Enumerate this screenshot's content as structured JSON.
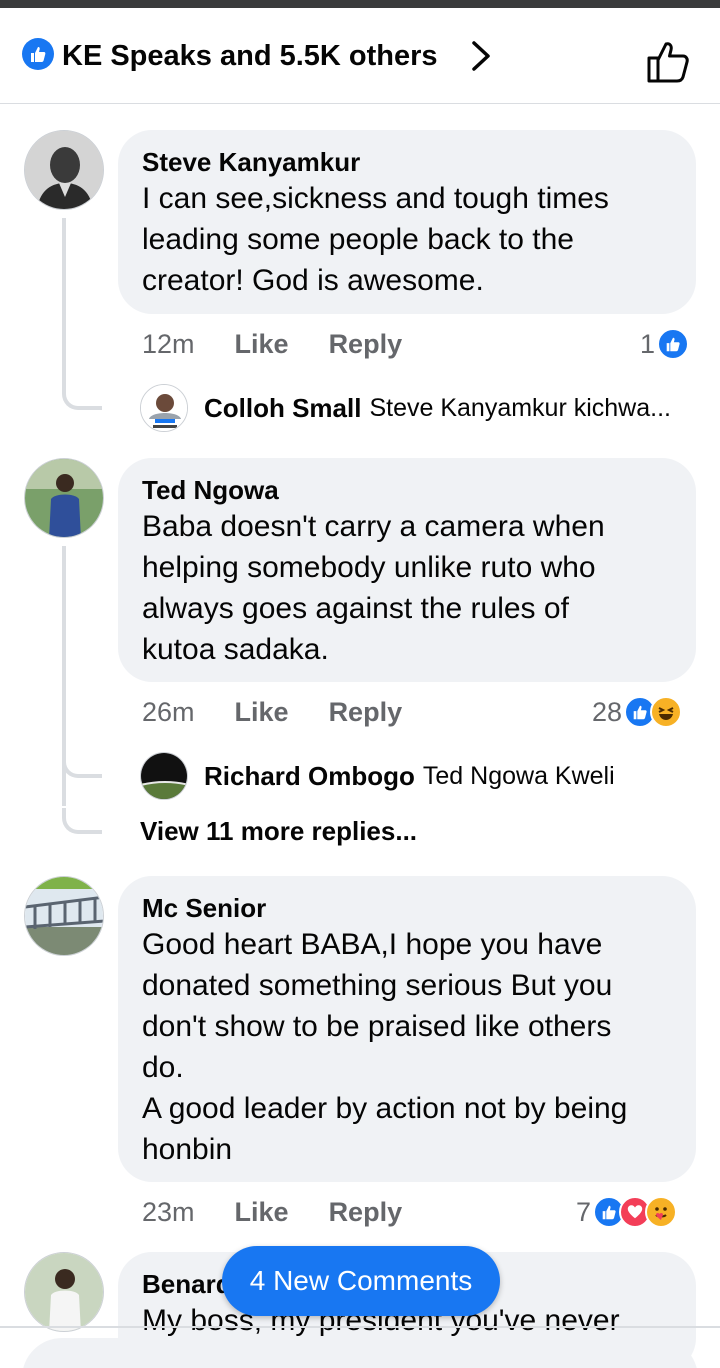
{
  "header": {
    "summary": "KE Speaks and 5.5K others"
  },
  "comments": [
    {
      "author": "Steve Kanyamkur",
      "text": "I can see,sickness and tough times\nleading some people back to the\ncreator! God is awesome.",
      "time": "12m",
      "like_label": "Like",
      "reply_label": "Reply",
      "reaction_count": "1",
      "reply": {
        "author": "Colloh Small",
        "text": "Steve Kanyamkur kichwa..."
      }
    },
    {
      "author": "Ted Ngowa",
      "text": "Baba doesn't carry a camera when\nhelping somebody unlike ruto who\nalways goes against the rules of\nkutoa sadaka.",
      "time": "26m",
      "like_label": "Like",
      "reply_label": "Reply",
      "reaction_count": "28",
      "reply": {
        "author": "Richard Ombogo",
        "text": "Ted Ngowa Kweli"
      },
      "view_more": "View 11 more replies..."
    },
    {
      "author": "Mc Senior",
      "text": "Good heart BABA,I hope you have\ndonated something serious But you\ndon't show to be praised like others\ndo.\nA good leader by action not by being\nhonbin",
      "time": "23m",
      "like_label": "Like",
      "reply_label": "Reply",
      "reaction_count": "7"
    },
    {
      "author": "Benard",
      "text": "My boss, my president you've never"
    }
  ],
  "new_comments_label": "4 New Comments",
  "colors": {
    "accent": "#1877f2",
    "bubble": "#f0f2f5",
    "secondary_text": "#65676b",
    "love": "#f33e58",
    "haha": "#f7b125"
  }
}
